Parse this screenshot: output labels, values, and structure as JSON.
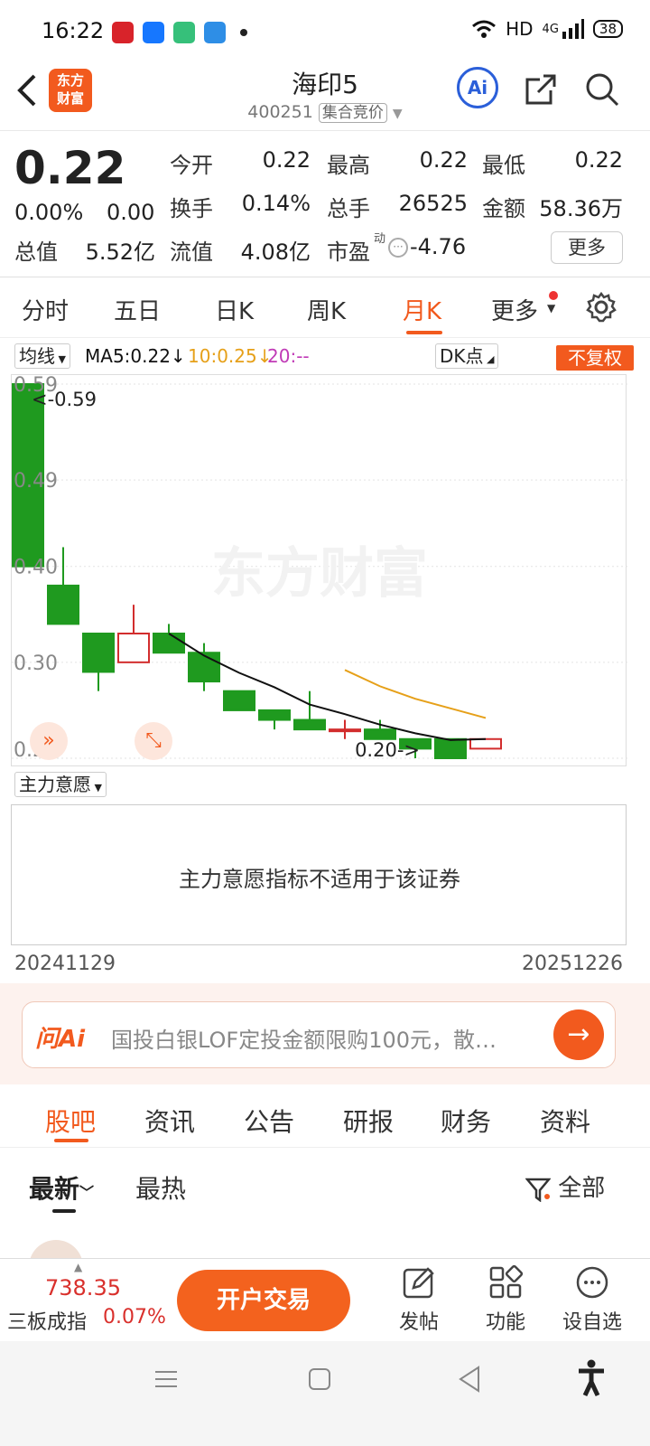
{
  "status_bar": {
    "time": "16:22",
    "network": "HD",
    "signal": "4G",
    "battery": "38"
  },
  "header": {
    "title": "海印5",
    "code": "400251",
    "tag": "集合竞价",
    "logo_text": "东方财富",
    "ai_label": "Ai",
    "accent": "#f25a1e"
  },
  "quote": {
    "price": "0.22",
    "change_pct": "0.00%",
    "change_val": "0.00",
    "fields": [
      {
        "label": "今开",
        "value": "0.22"
      },
      {
        "label": "最高",
        "value": "0.22"
      },
      {
        "label": "最低",
        "value": "0.22"
      },
      {
        "label": "换手",
        "value": "0.14%"
      },
      {
        "label": "总手",
        "value": "26525"
      },
      {
        "label": "金额",
        "value": "58.36万"
      }
    ],
    "row3": {
      "zongzhi_label": "总值",
      "zongzhi": "5.52亿",
      "liuzhi_label": "流值",
      "liuzhi": "4.08亿",
      "pe_label": "市盈",
      "pe_sup": "动",
      "pe": "-4.76"
    },
    "more": "更多"
  },
  "tabs": [
    "分时",
    "五日",
    "日K",
    "周K",
    "月K",
    "更多"
  ],
  "active_tab": "月K",
  "chart_head": {
    "ma_select": "均线",
    "ma5": "MA5:0.22↓",
    "ma10": "10:0.25↓",
    "ma20": "20:--",
    "dk": "DK点",
    "fuquan": "不复权"
  },
  "chart_data": {
    "type": "candlestick",
    "y_ticks": [
      "0.59",
      "0.49",
      "0.40",
      "0.30",
      "0.20"
    ],
    "ylim": [
      0.2,
      0.59
    ],
    "max_label": "<-0.59",
    "min_label": "0.20->",
    "candles": [
      {
        "open": 0.59,
        "close": 0.4,
        "high": 0.59,
        "low": 0.4
      },
      {
        "open": 0.38,
        "close": 0.34,
        "high": 0.42,
        "low": 0.34
      },
      {
        "open": 0.33,
        "close": 0.29,
        "high": 0.33,
        "low": 0.27
      },
      {
        "open": 0.3,
        "close": 0.33,
        "high": 0.36,
        "low": 0.3
      },
      {
        "open": 0.33,
        "close": 0.31,
        "high": 0.34,
        "low": 0.31
      },
      {
        "open": 0.31,
        "close": 0.28,
        "high": 0.32,
        "low": 0.27
      },
      {
        "open": 0.27,
        "close": 0.25,
        "high": 0.27,
        "low": 0.25
      },
      {
        "open": 0.25,
        "close": 0.24,
        "high": 0.25,
        "low": 0.23
      },
      {
        "open": 0.24,
        "close": 0.23,
        "high": 0.27,
        "low": 0.23
      },
      {
        "open": 0.23,
        "close": 0.23,
        "high": 0.24,
        "low": 0.22
      },
      {
        "open": 0.23,
        "close": 0.22,
        "high": 0.24,
        "low": 0.22
      },
      {
        "open": 0.22,
        "close": 0.21,
        "high": 0.22,
        "low": 0.2
      },
      {
        "open": 0.22,
        "close": 0.2,
        "high": 0.22,
        "low": 0.2
      },
      {
        "open": 0.21,
        "close": 0.22,
        "high": 0.22,
        "low": 0.21
      }
    ],
    "ma5": [
      null,
      null,
      null,
      null,
      0.33,
      0.307,
      0.289,
      0.274,
      0.256,
      0.246,
      0.235,
      0.226,
      0.219,
      0.22
    ],
    "ma10": [
      null,
      null,
      null,
      null,
      null,
      null,
      null,
      null,
      null,
      0.292,
      0.275,
      0.262,
      0.252,
      0.242
    ],
    "colors": {
      "up": "#d22d2d",
      "down": "#1f9a1f",
      "ma5": "#111111",
      "ma10": "#e6a019"
    },
    "watermark": "东方财富"
  },
  "indicator": {
    "select": "主力意愿",
    "message": "主力意愿指标不适用于该证券"
  },
  "dates": {
    "start": "20241129",
    "end": "20251226"
  },
  "ai_bar": {
    "logo": "问Ai",
    "text": "国投白银LOF定投金额限购100元，散…"
  },
  "section_tabs": [
    "股吧",
    "资讯",
    "公告",
    "研报",
    "财务",
    "资料"
  ],
  "sort": {
    "latest": "最新",
    "hot": "最热",
    "filter": "全部"
  },
  "bottom": {
    "index_value": "738.35",
    "index_name": "三板成指",
    "index_change": "0.07%",
    "trade": "开户交易",
    "post": "发帖",
    "func": "功能",
    "watch": "设自选"
  }
}
